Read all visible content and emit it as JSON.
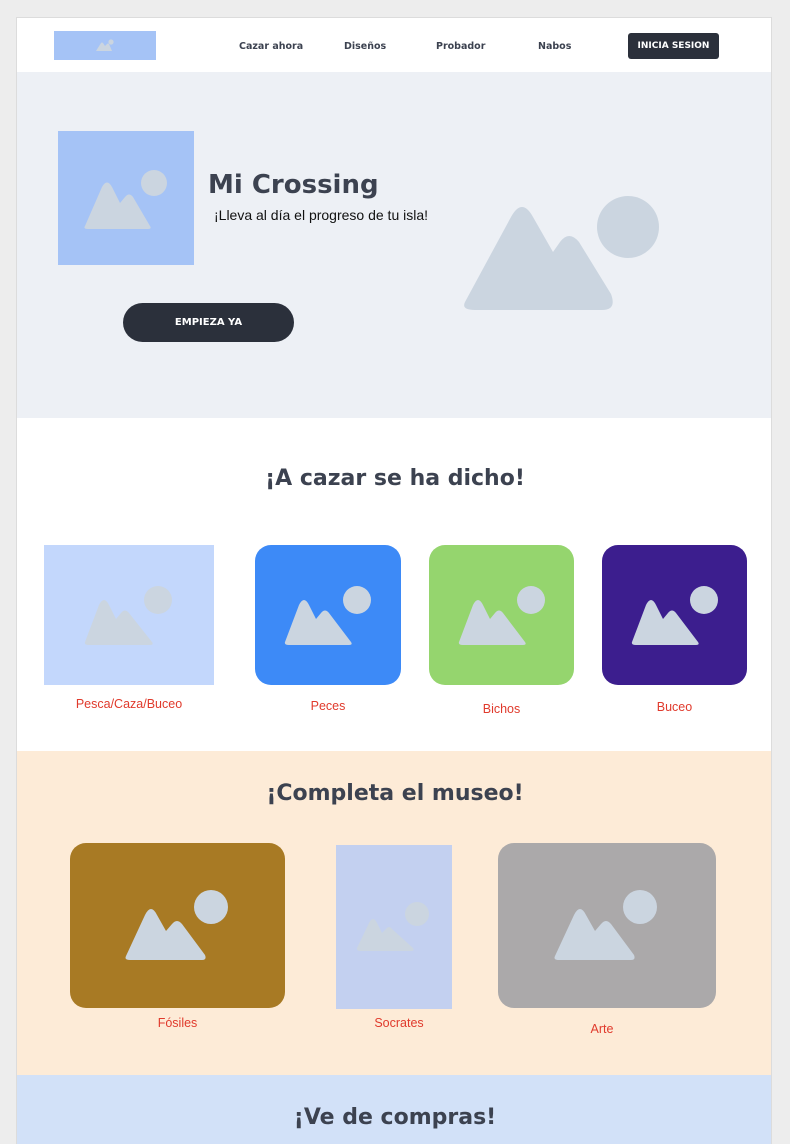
{
  "colors": {
    "page_bg": "#ededed",
    "hero_bg": "#edf0f5",
    "museum_bg": "#fdebd7",
    "shop_bg": "#d2e1f8",
    "dark_button": "#2b303b",
    "heading_text": "#3c4250",
    "caption_text": "#e03a2c",
    "placeholder_light": "#a5c3f6",
    "placeholder_glyph": "#cbd5e0"
  },
  "header": {
    "nav": [
      "Cazar ahora",
      "Diseños",
      "Probador",
      "Nabos"
    ],
    "login_label": "INICIA SESION",
    "logo_icon": "image-placeholder-icon"
  },
  "hero": {
    "title": "Mi Crossing",
    "subtitle": "¡Lleva al día el progreso de tu isla!",
    "cta_label": "EMPIEZA YA"
  },
  "hunt": {
    "title": "¡A cazar se ha dicho!",
    "cards": [
      {
        "label": "Pesca/Caza/Buceo",
        "color": "#c3d7fc"
      },
      {
        "label": "Peces",
        "color": "#3d8af7"
      },
      {
        "label": "Bichos",
        "color": "#95d56e"
      },
      {
        "label": "Buceo",
        "color": "#3c1e8e"
      }
    ]
  },
  "museum": {
    "title": "¡Completa el museo!",
    "cards": [
      {
        "label": "Fósiles",
        "color": "#a87a24"
      },
      {
        "label": "Socrates",
        "color": "#c3d0f0"
      },
      {
        "label": "Arte",
        "color": "#aba9aa"
      }
    ]
  },
  "shop": {
    "title": "¡Ve de compras!"
  }
}
